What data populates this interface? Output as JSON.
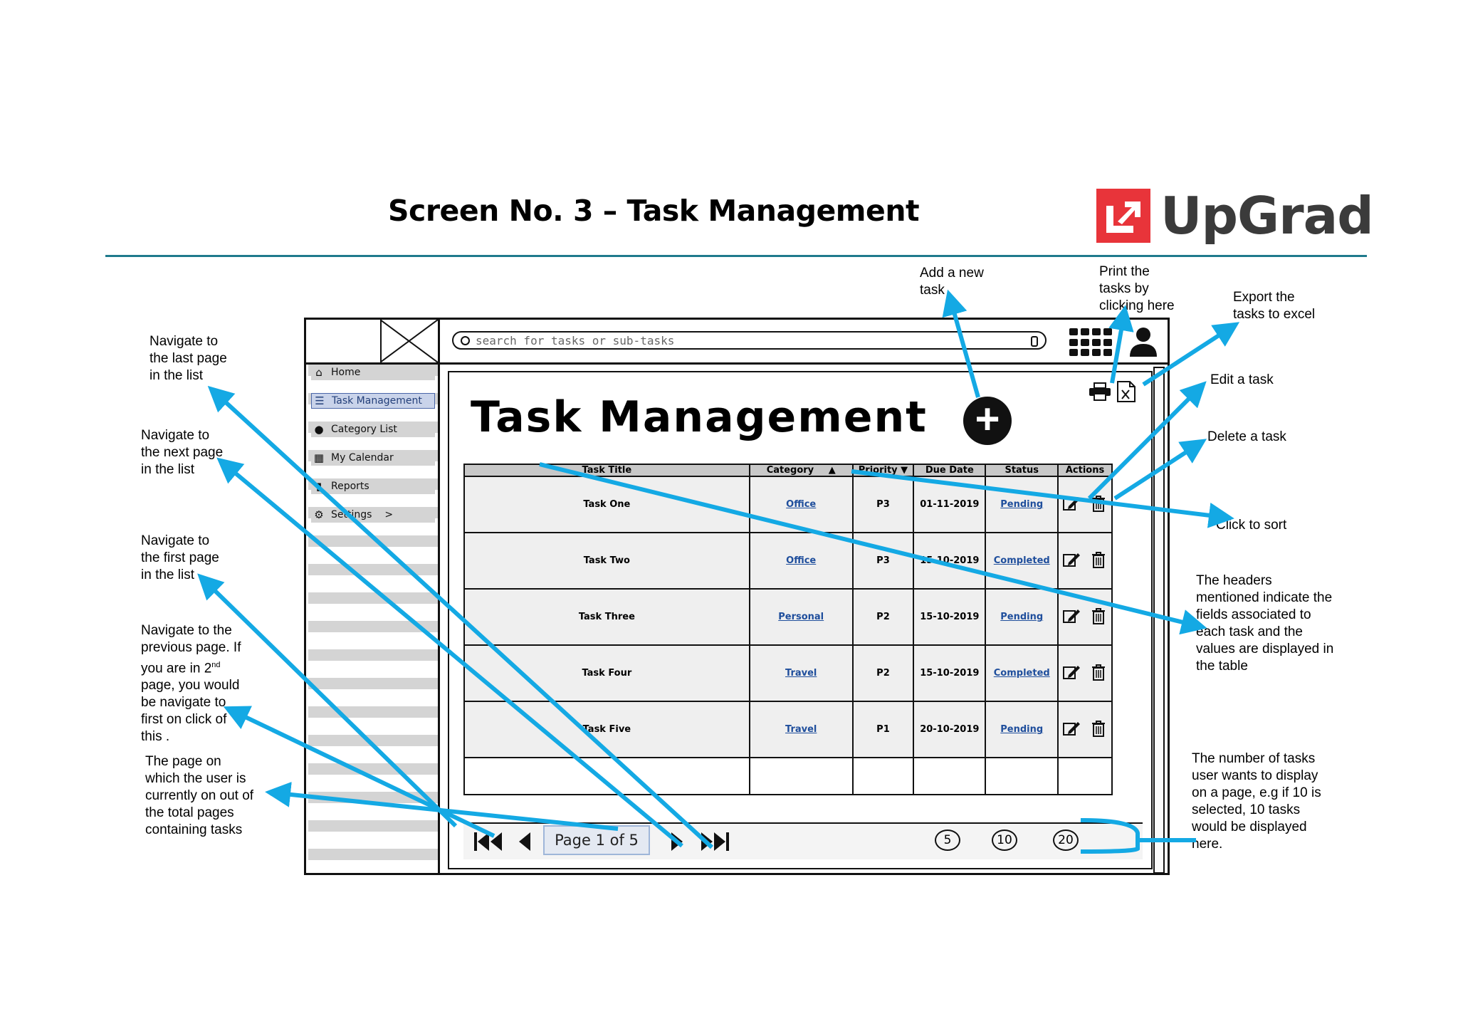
{
  "slide": {
    "title": "Screen No. 3 – Task Management",
    "brand": "UpGrad"
  },
  "app": {
    "search_placeholder": "search for tasks or sub-tasks",
    "page_title": "Task Management",
    "sidebar": [
      {
        "label": "Home",
        "icon": "home-icon"
      },
      {
        "label": "Task Management",
        "icon": "list-icon",
        "active": true
      },
      {
        "label": "Category List",
        "icon": "dot-icon"
      },
      {
        "label": "My Calendar",
        "icon": "calendar-icon"
      },
      {
        "label": "Reports",
        "icon": "bar-chart-icon"
      },
      {
        "label": "Settings",
        "icon": "gear-icon"
      }
    ],
    "table": {
      "headers": [
        "Task Title",
        "Category",
        "Priority",
        "Due Date",
        "Status",
        "Actions"
      ],
      "rows": [
        {
          "title": "Task One",
          "category": "Office",
          "priority": "P3",
          "due": "01-11-2019",
          "status": "Pending"
        },
        {
          "title": "Task Two",
          "category": "Office",
          "priority": "P3",
          "due": "15-10-2019",
          "status": "Completed"
        },
        {
          "title": "Task Three",
          "category": "Personal",
          "priority": "P2",
          "due": "15-10-2019",
          "status": "Pending"
        },
        {
          "title": "Task Four",
          "category": "Travel",
          "priority": "P2",
          "due": "15-10-2019",
          "status": "Completed"
        },
        {
          "title": "Task Five",
          "category": "Travel",
          "priority": "P1",
          "due": "20-10-2019",
          "status": "Pending"
        }
      ]
    },
    "pager": {
      "label": "Page 1 of 5",
      "sizes": [
        "5",
        "10",
        "20"
      ]
    }
  },
  "notes": {
    "last_page": [
      "Navigate to",
      "the last page",
      "in the list"
    ],
    "next_page": [
      "Navigate to",
      "the next page",
      "in the list"
    ],
    "first_page": [
      "Navigate to",
      "the first page",
      "in the list"
    ],
    "prev_page": [
      "Navigate to the",
      "previous page. If",
      "you are in 2",
      "nd",
      "page, you would",
      "be navigate to",
      "first on click of",
      "this ."
    ],
    "current_page": [
      "The page on",
      "which the user is",
      "currently on out of",
      "the total pages",
      "containing tasks"
    ],
    "add_task": [
      "Add a new",
      "task"
    ],
    "print": [
      "Print the",
      "tasks by",
      "clicking here"
    ],
    "export": [
      "Export the",
      "tasks to excel"
    ],
    "edit": "Edit a task",
    "delete": "Delete a task",
    "sort": "Click to sort",
    "headers": [
      "The headers",
      "mentioned indicate the",
      "fields associated to",
      "each task and the",
      "values are displayed in",
      "the table"
    ],
    "page_size": [
      "The number of tasks",
      "user wants to display",
      "on a page, e.g if 10 is",
      "selected, 10 tasks",
      "would be displayed",
      "here."
    ]
  },
  "colors": {
    "annotation": "#14a9e4",
    "brand_red": "#e8343a",
    "brand_text": "#3b3b3b",
    "rule": "#1f7a8c"
  }
}
